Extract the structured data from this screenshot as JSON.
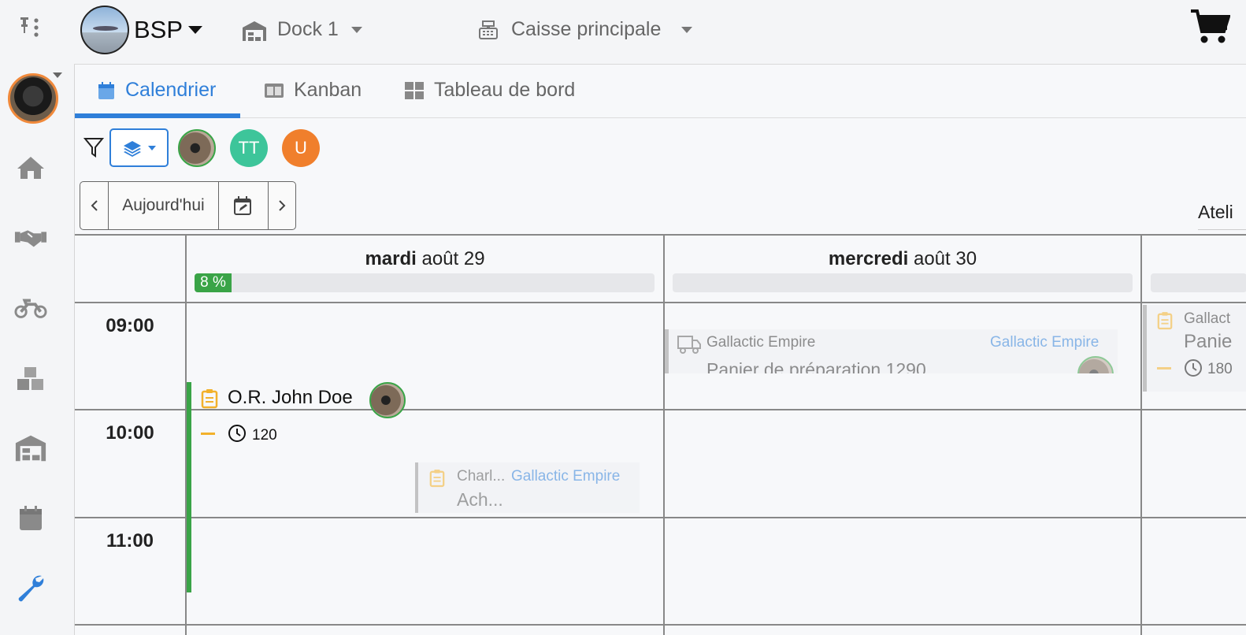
{
  "sidebar": {
    "items": [
      {
        "name": "pin-menu-icon"
      },
      {
        "name": "home-icon"
      },
      {
        "name": "handshake-icon"
      },
      {
        "name": "motorcycle-icon"
      },
      {
        "name": "boxes-icon"
      },
      {
        "name": "warehouse-icon"
      },
      {
        "name": "calendar-icon"
      },
      {
        "name": "wrench-icon"
      }
    ],
    "active_color": "#2f7fd9"
  },
  "topbar": {
    "org_name": "BSP",
    "dock_label": "Dock 1",
    "register_label": "Caisse principale"
  },
  "tabs": [
    {
      "label": "Calendrier",
      "active": true
    },
    {
      "label": "Kanban",
      "active": false
    },
    {
      "label": "Tableau de bord",
      "active": false
    }
  ],
  "filters": {
    "avatars": [
      {
        "initials": "",
        "color": "#6d5c4a"
      },
      {
        "initials": "TT",
        "color": "#3dc59a"
      },
      {
        "initials": "U",
        "color": "#f07f2c"
      }
    ]
  },
  "nav": {
    "today_label": "Aujourd'hui"
  },
  "view_selector_label": "Ateli",
  "calendar": {
    "days": [
      {
        "bold": "mardi",
        "rest": " août 29",
        "load_label": "8 %",
        "load": 0.08
      },
      {
        "bold": "mercredi",
        "rest": " août 30",
        "load_label": "",
        "load": 0
      }
    ],
    "hours": [
      "09:00",
      "10:00",
      "11:00"
    ],
    "events": {
      "main": {
        "title": "O.R. John Doe",
        "duration": "120",
        "bar_color": "#3aa447"
      },
      "small": {
        "client": "Charl...",
        "company": "Gallactic Empire",
        "title": "Ach..."
      },
      "wed": {
        "client": "Gallactic Empire",
        "company": "Gallactic Empire",
        "title": "Panier de préparation 1290"
      },
      "thu": {
        "client": "Gallact",
        "title": "Panie",
        "duration": "180"
      }
    }
  }
}
